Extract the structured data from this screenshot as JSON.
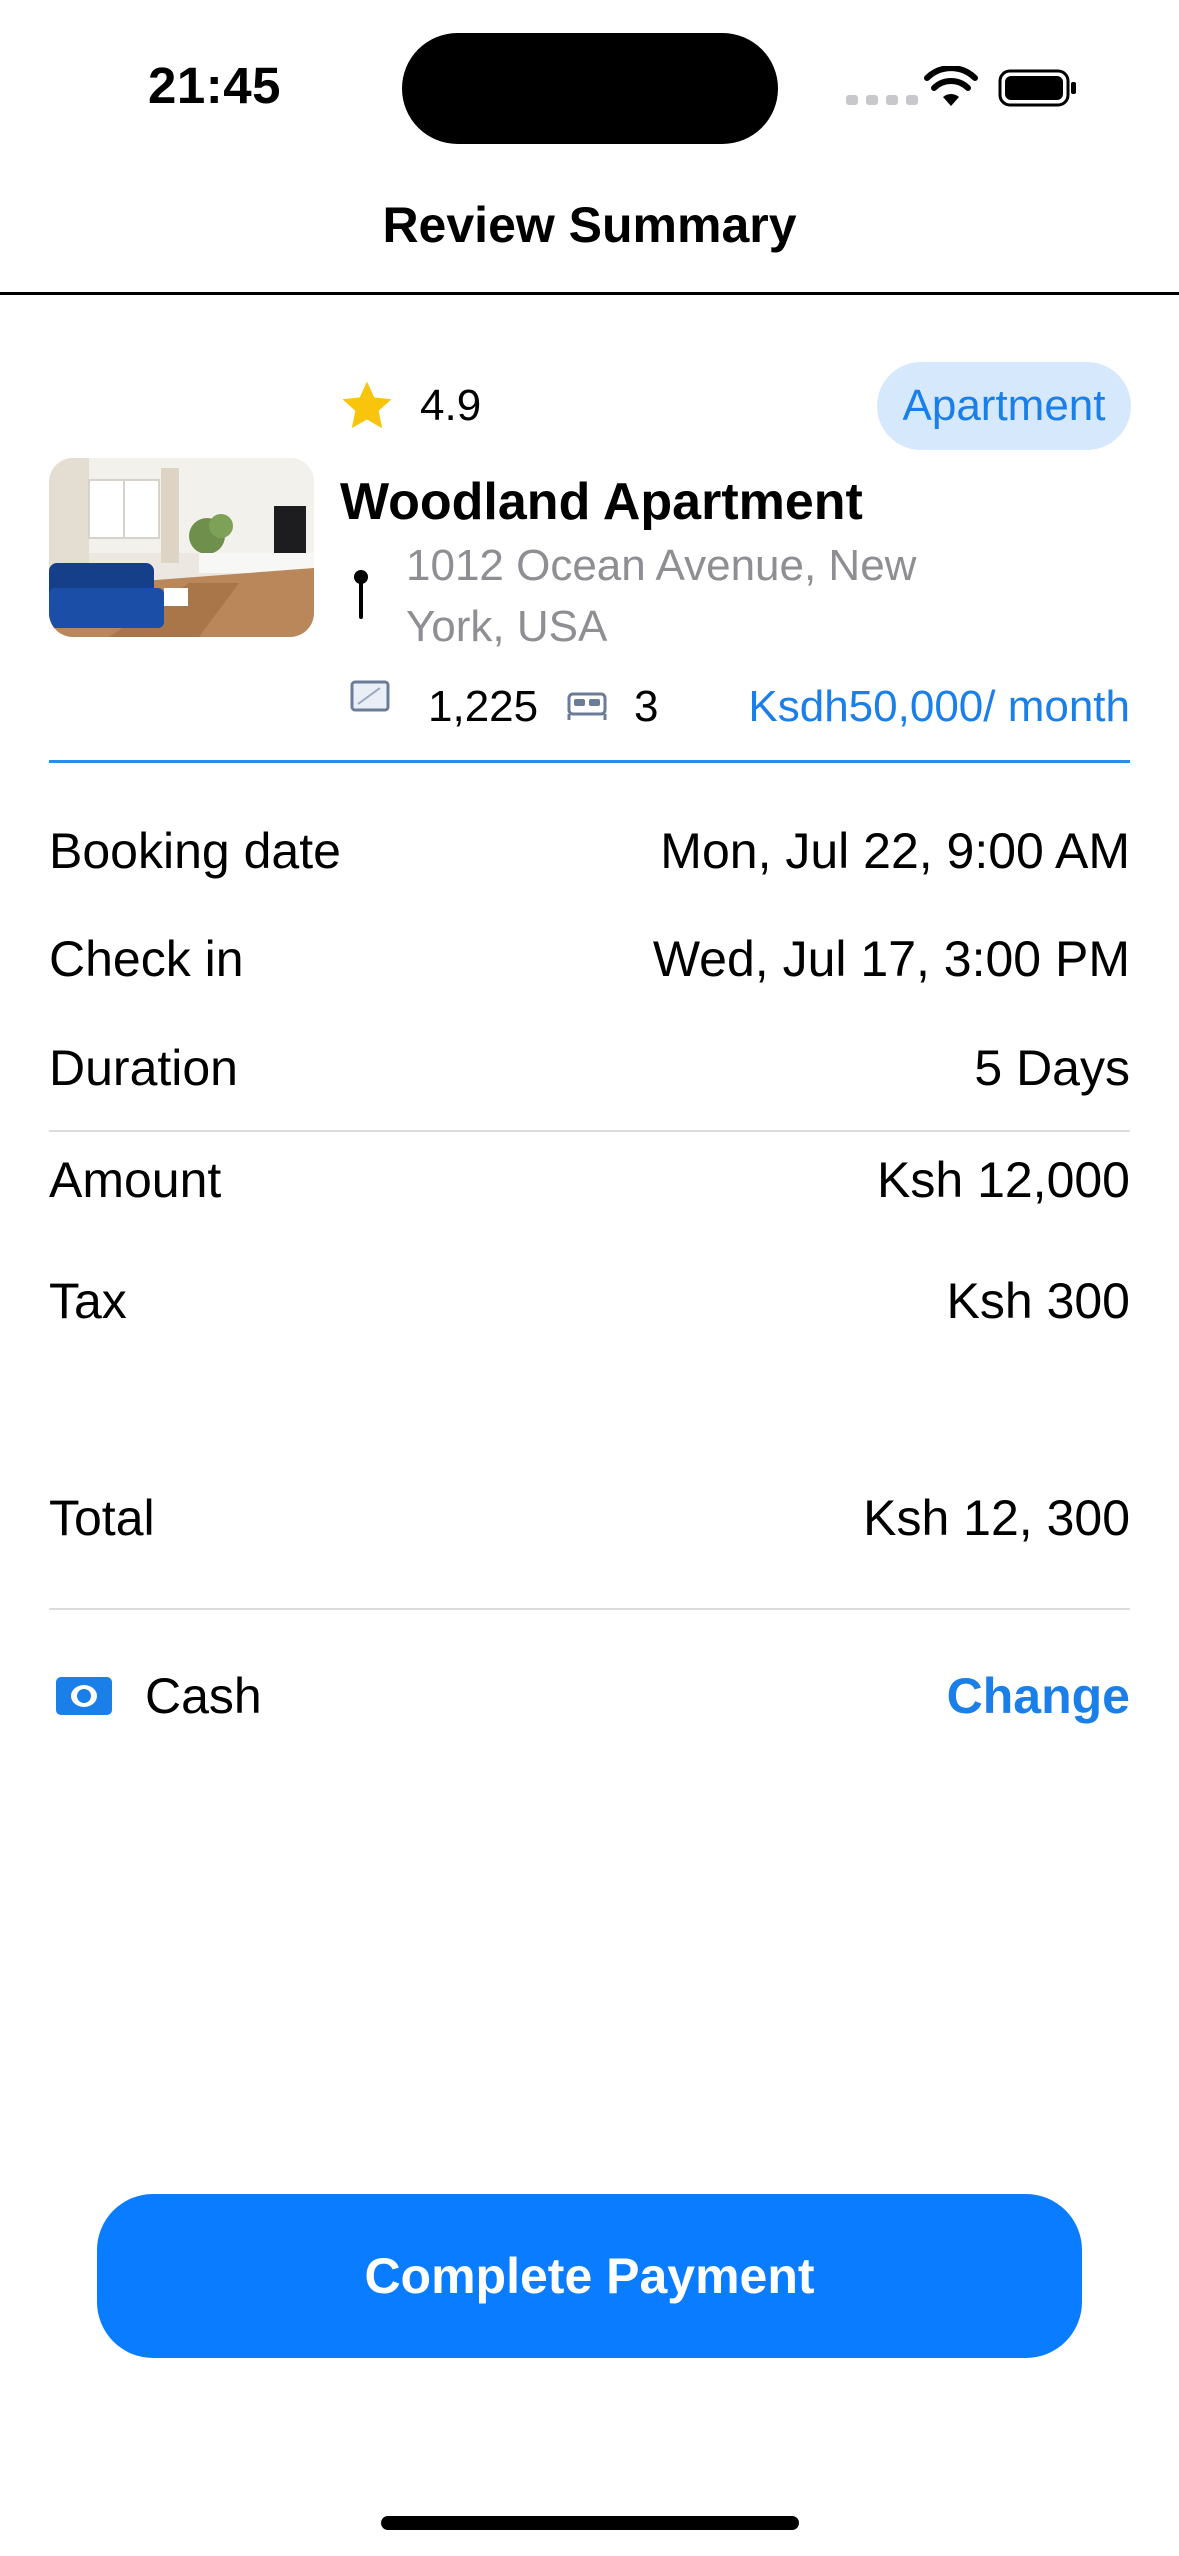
{
  "status_bar": {
    "time": "21:45",
    "icons": [
      "signal-icon",
      "wifi-icon",
      "battery-icon"
    ]
  },
  "nav": {
    "title": "Review Summary"
  },
  "property": {
    "rating": "4.9",
    "rating_icon": "star-icon",
    "type_badge": "Apartment",
    "name": "Woodland Apartment",
    "address": "1012 Ocean Avenue, New York, USA",
    "area": "1,225",
    "bedrooms": "3",
    "price": "Ksdh50,000/ month",
    "icons": [
      "property-photo",
      "location-pin-icon",
      "area-icon",
      "bed-icon"
    ]
  },
  "details": {
    "booking_date": {
      "label": "Booking date",
      "value": "Mon, Jul 22, 9:00 AM"
    },
    "check_in": {
      "label": "Check in",
      "value": "Wed, Jul 17, 3:00 PM"
    },
    "duration": {
      "label": "Duration",
      "value": "5 Days"
    },
    "amount": {
      "label": "Amount",
      "value": "Ksh 12,000"
    },
    "tax": {
      "label": "Tax",
      "value": "Ksh 300"
    },
    "total": {
      "label": "Total",
      "value": "Ksh 12, 300"
    }
  },
  "payment": {
    "method": "Cash",
    "method_icon": "cash-icon",
    "change_label": "Change"
  },
  "cta": {
    "label": "Complete Payment"
  },
  "colors": {
    "accent": "#0a7cff",
    "link": "#1a7fe8",
    "badge_bg": "#d6e8fb",
    "star": "#f8c40c",
    "secondary_text": "#8e8e93"
  }
}
